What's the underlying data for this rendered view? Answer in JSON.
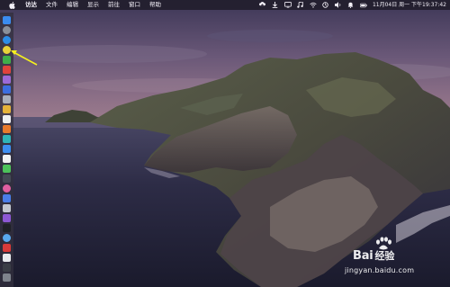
{
  "menubar": {
    "apple_icon": "apple-icon",
    "app_name": "访达",
    "items": [
      "文件",
      "编辑",
      "显示",
      "前往",
      "窗口",
      "帮助"
    ],
    "status_icons": [
      "upload-icon",
      "download-icon",
      "monitor-icon",
      "music-icon",
      "wifi-icon",
      "sync-icon",
      "volume-icon",
      "bell-icon",
      "battery-icon"
    ],
    "clock": "11月04日 周一 下午19:37:42"
  },
  "dock": {
    "items": [
      {
        "name": "finder-icon",
        "color": "#3a8cf0"
      },
      {
        "name": "launchpad-icon",
        "color": "#8a8f99"
      },
      {
        "name": "safari-icon",
        "color": "#2c8de8"
      },
      {
        "name": "chrome-icon",
        "color": "#e8d23a"
      },
      {
        "name": "app-green-icon",
        "color": "#3fae4a"
      },
      {
        "name": "app-red-icon",
        "color": "#e0433c"
      },
      {
        "name": "app-purple-icon",
        "color": "#9b6ad8"
      },
      {
        "name": "app-blue-icon",
        "color": "#3b6ee0"
      },
      {
        "name": "app-gray-icon",
        "color": "#aab0bb"
      },
      {
        "name": "app-yellow-icon",
        "color": "#e6b33a"
      },
      {
        "name": "app-white-icon",
        "color": "#eef0f3"
      },
      {
        "name": "app-orange-icon",
        "color": "#e87a2c"
      },
      {
        "name": "app-teal-icon",
        "color": "#2fb4b8"
      },
      {
        "name": "app-blue2-icon",
        "color": "#3e8ef0"
      },
      {
        "name": "app-white2-icon",
        "color": "#f2f2f2"
      },
      {
        "name": "app-green2-icon",
        "color": "#4cc25a"
      },
      {
        "name": "app-dark-icon",
        "color": "#444955"
      },
      {
        "name": "app-pink-icon",
        "color": "#e05ea0"
      },
      {
        "name": "app-blue3-icon",
        "color": "#4a7de8"
      },
      {
        "name": "app-silver-icon",
        "color": "#c3c7cf"
      },
      {
        "name": "app-violet-icon",
        "color": "#8d58d4"
      },
      {
        "name": "app-black-icon",
        "color": "#1f2126"
      },
      {
        "name": "app-sky-icon",
        "color": "#58a8ee"
      },
      {
        "name": "app-red2-icon",
        "color": "#d83a3a"
      },
      {
        "name": "app-white3-icon",
        "color": "#e9ebef"
      },
      {
        "name": "app-dark2-icon",
        "color": "#3a3d46"
      },
      {
        "name": "trash-icon",
        "color": "#7e838c"
      }
    ]
  },
  "annotation": {
    "arrow_color": "#f4f01e"
  },
  "watermark": {
    "brand_prefix": "Bai",
    "brand_cn": "经验",
    "url": "jingyan.baidu.com"
  }
}
